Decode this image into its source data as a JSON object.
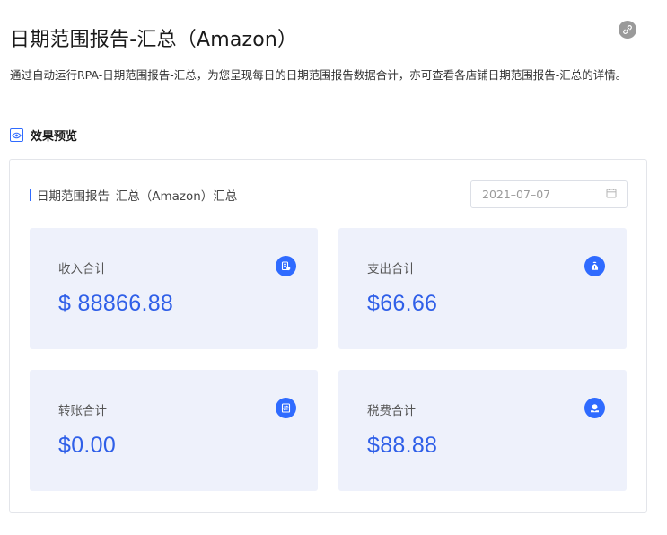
{
  "page": {
    "title": "日期范围报告-汇总（Amazon）",
    "description": "通过自动运行RPA-日期范围报告-汇总，为您呈现每日的日期范围报告数据合计，亦可查看各店铺日期范围报告-汇总的详情。",
    "link_icon": "link-icon"
  },
  "section": {
    "label": "效果预览",
    "icon": "eye-icon"
  },
  "preview": {
    "title": "日期范围报告–汇总（Amazon）汇总",
    "date_value": "2021–07–07",
    "date_icon": "calendar-icon",
    "stats": [
      {
        "label": "收入合计",
        "value": "$ 88866.88",
        "icon": "income-icon"
      },
      {
        "label": "支出合计",
        "value": "$66.66",
        "icon": "expense-icon"
      },
      {
        "label": "转账合计",
        "value": "$0.00",
        "icon": "transfer-icon"
      },
      {
        "label": "税费合计",
        "value": "$88.88",
        "icon": "tax-icon"
      }
    ]
  },
  "colors": {
    "accent": "#2f6bff",
    "stat_bg": "#eef1fb",
    "value_text": "#2f5fe8"
  }
}
